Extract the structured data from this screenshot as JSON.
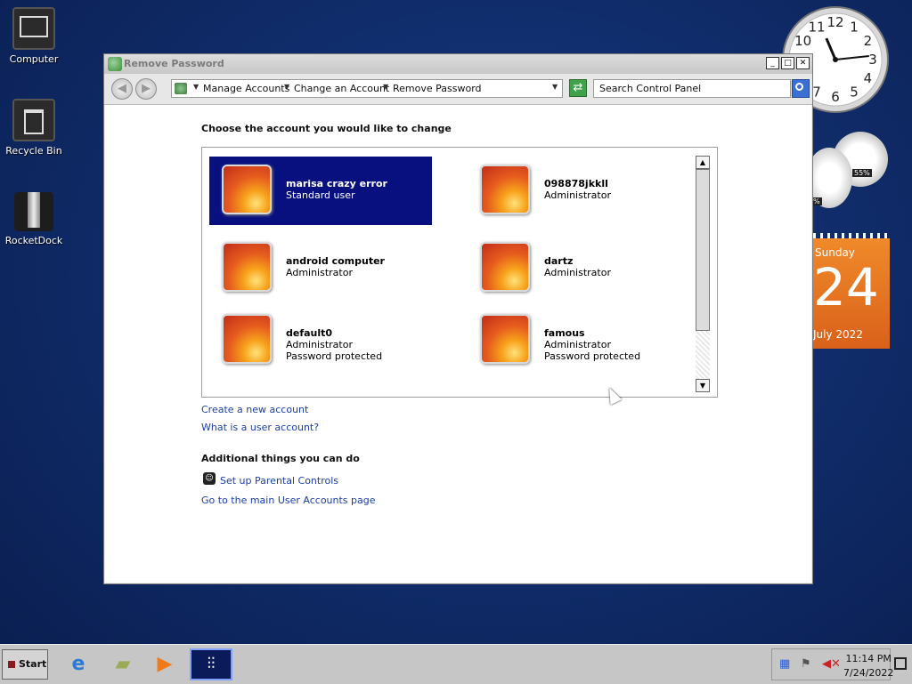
{
  "desktop": {
    "icons": [
      {
        "label": "Computer"
      },
      {
        "label": "Recycle Bin"
      },
      {
        "label": "RocketDock"
      }
    ]
  },
  "gadgets": {
    "clock": {
      "hour": 11,
      "minute": 14,
      "numerals": [
        "12",
        "1",
        "2",
        "3",
        "4",
        "5",
        "6",
        "7",
        "8",
        "9",
        "10",
        "11"
      ]
    },
    "meter": {
      "cpu_percent": "55%",
      "ram_percent": "%"
    },
    "calendar": {
      "weekday": "Sunday",
      "day": "24",
      "month_year": "July 2022"
    }
  },
  "window": {
    "title": "Remove Password",
    "breadcrumbs": [
      "Manage Accounts",
      "Change an Account",
      "Remove Password"
    ],
    "search_placeholder": "Search Control Panel",
    "heading": "Choose the account you would like to change",
    "accounts": [
      {
        "name": "marisa crazy error",
        "line1": "Standard user",
        "line2": "",
        "selected": true
      },
      {
        "name": "098878jkkll",
        "line1": "Administrator",
        "line2": ""
      },
      {
        "name": "android computer",
        "line1": "Administrator",
        "line2": ""
      },
      {
        "name": "dartz",
        "line1": "Administrator",
        "line2": ""
      },
      {
        "name": "default0",
        "line1": "Administrator",
        "line2": "Password protected"
      },
      {
        "name": "famous",
        "line1": "Administrator",
        "line2": "Password protected"
      }
    ],
    "links": {
      "create_account": "Create a new account",
      "what_is": "What is a user account?",
      "additional_heading": "Additional things you can do",
      "parental": "Set up Parental Controls",
      "main_page": "Go to the main User Accounts page"
    }
  },
  "taskbar": {
    "start_label": "Start",
    "time": "11:14 PM",
    "date": "7/24/2022"
  }
}
